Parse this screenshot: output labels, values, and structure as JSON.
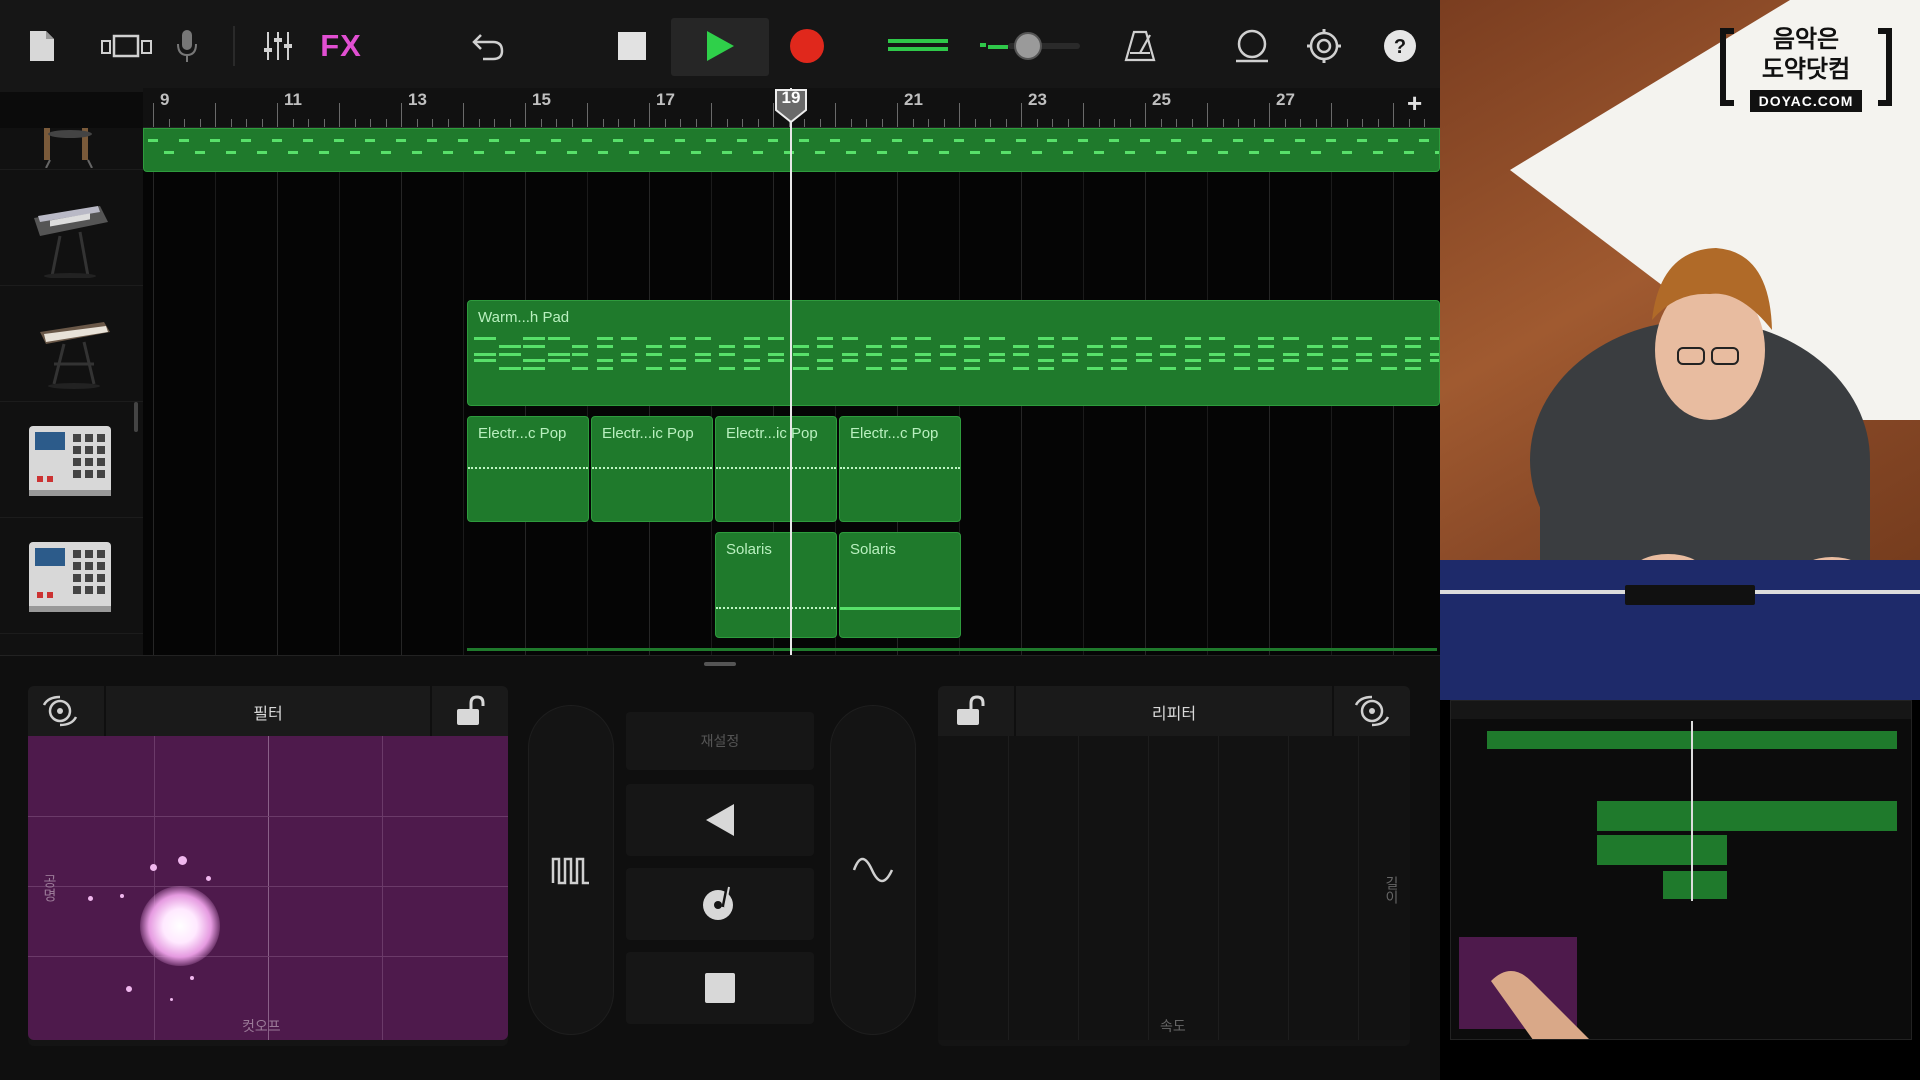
{
  "toolbar": {
    "fx_label": "FX",
    "buttons": [
      "my-songs",
      "browser",
      "mic",
      "mixer",
      "fx",
      "undo",
      "stop",
      "play",
      "record",
      "master-volume",
      "metronome",
      "loop-browser",
      "settings",
      "help"
    ]
  },
  "ruler": {
    "bars": [
      "9",
      "11",
      "13",
      "15",
      "17",
      "19",
      "21",
      "23",
      "25",
      "27"
    ],
    "playhead_bar": "19",
    "add_label": "+"
  },
  "tracks": [
    {
      "instrument": "drum-kit"
    },
    {
      "instrument": "synth-keyboard"
    },
    {
      "instrument": "synth-keyboard-2"
    },
    {
      "instrument": "beat-sequencer"
    },
    {
      "instrument": "beat-sequencer-2"
    }
  ],
  "regions": {
    "pad": "Warm...h Pad",
    "electro": [
      "Electr...c Pop",
      "Electr...ic Pop",
      "Electr...ic Pop",
      "Electr...c Pop"
    ],
    "solaris": [
      "Solaris",
      "Solaris"
    ]
  },
  "fx_panel_left": {
    "title": "필터",
    "y_axis": "공명",
    "x_axis": "컷오프"
  },
  "fx_panel_right": {
    "title": "리피터",
    "y_axis": "길이",
    "x_axis": "속도"
  },
  "center_controls": {
    "reset_label": "재설정"
  },
  "watermark": {
    "line1": "음악은",
    "line2": "도약닷컴",
    "url": "DOYAC.COM"
  },
  "colors": {
    "region_green": "#1f7a2c",
    "fx_pink": "#e14fd2",
    "record_red": "#e0281c",
    "play_green": "#2fd04a",
    "filter_pad": "#4e1a4c"
  }
}
